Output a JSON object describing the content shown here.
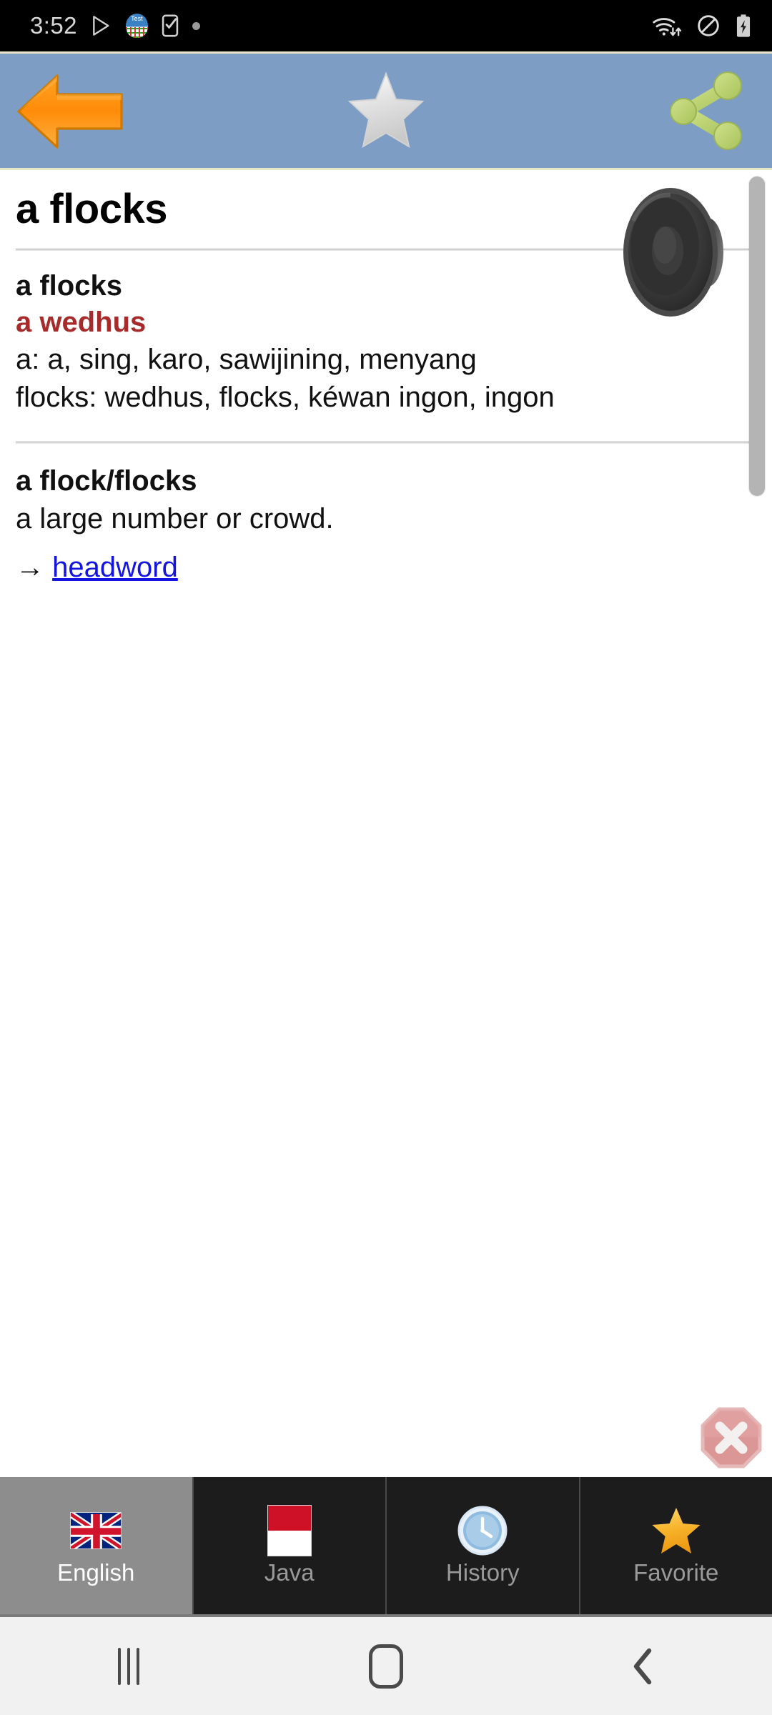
{
  "statusbar": {
    "time": "3:52",
    "left_icons": [
      {
        "name": "play-store-icon"
      },
      {
        "name": "test-app-icon",
        "label": "Test"
      },
      {
        "name": "phone-check-icon"
      },
      {
        "name": "dot-indicator-icon"
      }
    ],
    "right_icons": [
      {
        "name": "wifi-transfer-icon"
      },
      {
        "name": "do-not-disturb-icon"
      },
      {
        "name": "battery-charging-icon"
      }
    ]
  },
  "toolbar": {
    "back_label": "Back",
    "favorite_label": "Favorite",
    "share_label": "Share",
    "favorite_active": false,
    "background_color": "#7d9dc4"
  },
  "entry": {
    "headword": "a flocks",
    "speaker_label": "Pronounce",
    "sense": {
      "term": "a flocks",
      "translation": "a wedhus",
      "gloss_lines": [
        "a: a, sing, karo, sawijining, menyang",
        "flocks: wedhus, flocks, kéwan ingon, ingon"
      ]
    },
    "definition": {
      "term": "a flock/flocks",
      "text": "a large number or crowd.",
      "xref_arrow": "→",
      "xref_link": "headword"
    },
    "translation_color": "#a82b2b",
    "link_color": "#1414e0"
  },
  "close_button": {
    "label": "Close"
  },
  "tabs": [
    {
      "label": "English",
      "icon": "uk-flag-icon",
      "active": true
    },
    {
      "label": "Java",
      "icon": "indonesia-flag-icon",
      "active": false
    },
    {
      "label": "History",
      "icon": "clock-icon",
      "active": false
    },
    {
      "label": "Favorite",
      "icon": "star-icon",
      "active": false
    }
  ],
  "navbar": {
    "recents_label": "Recents",
    "home_label": "Home",
    "back_label": "Back"
  }
}
